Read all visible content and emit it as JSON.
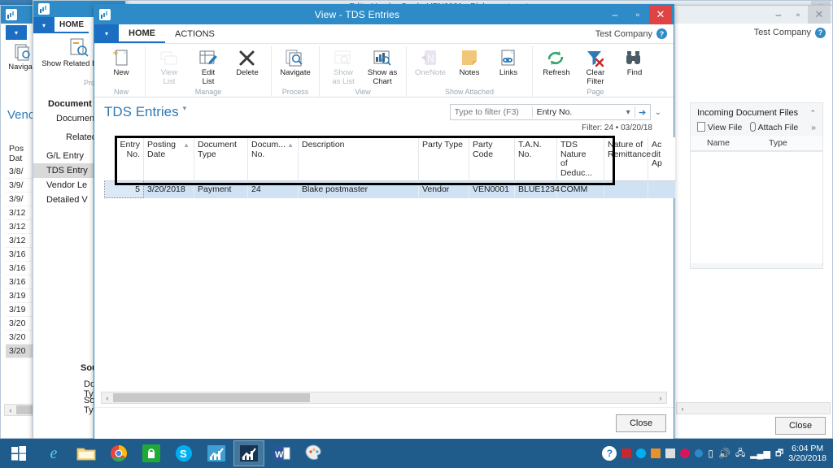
{
  "desktop": {
    "background_color": "#2f6a9c"
  },
  "back_window_right": {
    "title": "Edit - Vendor Card - VEN0001 - Blake postmaster",
    "company": "Test Company",
    "help_icon": "help-icon",
    "minimize": "–",
    "maximize": "▫",
    "close": "✕",
    "close_button": "Close"
  },
  "back_window_left": {
    "title_icon": "chart-app-icon",
    "tab_home": "HOME",
    "ribbon": {
      "show_related_entries": "Show Related Entries",
      "group_process": "Process",
      "navigate": "Navigate"
    },
    "sections": {
      "document": "Document",
      "document_no_label": "Document N",
      "related_entries_label": "Related E",
      "source": "Source",
      "document_type_label": "Document Ty",
      "source_type_label": "Source Type:"
    },
    "related_entries": [
      {
        "label": "G/L Entry",
        "selected": false
      },
      {
        "label": "TDS Entry",
        "selected": true
      },
      {
        "label": "Vendor Le",
        "selected": false
      },
      {
        "label": "Detailed V",
        "selected": false
      }
    ],
    "vendor_title": "Venc",
    "date_column_header_1": "Pos",
    "date_column_header_2": "Dat",
    "dates": [
      "3/8/",
      "3/9/",
      "3/9/",
      "3/12",
      "3/12",
      "3/12",
      "3/16",
      "3/16",
      "3/16",
      "3/19",
      "3/19",
      "3/20",
      "3/20",
      "3/20"
    ],
    "selected_date_index": 13
  },
  "dialog": {
    "title": "View - TDS Entries",
    "title_icon": "chart-app-icon",
    "minimize": "–",
    "maximize": "▫",
    "close": "✕",
    "company": "Test Company",
    "help_icon": "help-icon",
    "file_menu_icon": "chevron-down-icon",
    "tabs": [
      {
        "label": "HOME",
        "active": true
      },
      {
        "label": "ACTIONS",
        "active": false
      }
    ],
    "ribbon_groups": [
      {
        "label": "New",
        "buttons": [
          {
            "label": "New",
            "icon": "new-document-icon",
            "disabled": false
          }
        ]
      },
      {
        "label": "Manage",
        "buttons": [
          {
            "label": "View\nList",
            "icon": "view-list-icon",
            "disabled": true
          },
          {
            "label": "Edit\nList",
            "icon": "edit-list-icon",
            "disabled": false
          },
          {
            "label": "Delete",
            "icon": "delete-x-icon",
            "disabled": false
          }
        ]
      },
      {
        "label": "Process",
        "buttons": [
          {
            "label": "Navigate",
            "icon": "navigate-search-icon",
            "disabled": false
          }
        ]
      },
      {
        "label": "View",
        "buttons": [
          {
            "label": "Show\nas List",
            "icon": "show-as-list-icon",
            "disabled": true
          },
          {
            "label": "Show as\nChart",
            "icon": "show-as-chart-icon",
            "disabled": false
          }
        ]
      },
      {
        "label": "Show Attached",
        "buttons": [
          {
            "label": "OneNote",
            "icon": "onenote-icon",
            "disabled": true
          },
          {
            "label": "Notes",
            "icon": "notes-icon",
            "disabled": false
          },
          {
            "label": "Links",
            "icon": "links-icon",
            "disabled": false
          }
        ]
      },
      {
        "label": "Page",
        "buttons": [
          {
            "label": "Refresh",
            "icon": "refresh-icon",
            "disabled": false
          },
          {
            "label": "Clear\nFilter",
            "icon": "clear-filter-icon",
            "disabled": false
          },
          {
            "label": "Find",
            "icon": "find-binoculars-icon",
            "disabled": false
          }
        ]
      }
    ],
    "page_title": "TDS Entries",
    "page_title_caret": "▾",
    "search": {
      "placeholder": "Type to filter (F3)",
      "field_value": "Entry No.",
      "dropdown_icon": "chevron-down-icon",
      "go_icon": "arrow-right-icon",
      "expand_icon": "chevron-down-icon"
    },
    "filter_status": "Filter: 24 • 03/20/18",
    "grid": {
      "columns": [
        {
          "label": "Entry No.",
          "align": "right",
          "sort": false
        },
        {
          "label": "Posting\nDate",
          "align": "left",
          "sort": true
        },
        {
          "label": "Document\nType",
          "align": "left",
          "sort": false
        },
        {
          "label": "Docum...\nNo.",
          "align": "left",
          "sort": true
        },
        {
          "label": "Description",
          "align": "left",
          "sort": false
        },
        {
          "label": "Party Type",
          "align": "left",
          "sort": false
        },
        {
          "label": "Party Code",
          "align": "left",
          "sort": false
        },
        {
          "label": "T.A.N. No.",
          "align": "left",
          "sort": false
        },
        {
          "label": "TDS Nature\nof Deduc...",
          "align": "left",
          "sort": false
        },
        {
          "label": "Nature of\nRemittance",
          "align": "left",
          "sort": false
        },
        {
          "label": "Ac dit\nAp",
          "align": "left",
          "sort": false
        }
      ],
      "rows": [
        {
          "selected": true,
          "cells": [
            "5",
            "3/20/2018",
            "Payment",
            "24",
            "Blake postmaster",
            "Vendor",
            "VEN0001",
            "BLUE1234",
            "COMM",
            "",
            ""
          ]
        }
      ]
    },
    "scroll": {
      "left_arrow": "‹",
      "right_arrow": "›"
    },
    "close_button": "Close"
  },
  "factbox": {
    "title": "Incoming Document Files",
    "collapse_icon": "chevron-up-icon",
    "actions": [
      {
        "label": "View File",
        "icon": "document-icon"
      },
      {
        "label": "Attach File",
        "icon": "paperclip-icon"
      }
    ],
    "more_icon": "»",
    "columns": [
      "Name",
      "Type"
    ],
    "rows": []
  },
  "taskbar": {
    "start_icon": "windows-start-icon",
    "items": [
      {
        "name": "internet-explorer-icon",
        "active": false
      },
      {
        "name": "file-explorer-icon",
        "active": false
      },
      {
        "name": "chrome-icon",
        "active": false
      },
      {
        "name": "store-icon",
        "active": false
      },
      {
        "name": "skype-icon",
        "active": false
      },
      {
        "name": "dynamics-nav-icon",
        "active": false
      },
      {
        "name": "dynamics-nav-icon-2",
        "active": true
      },
      {
        "name": "word-icon",
        "active": false
      },
      {
        "name": "paint-icon",
        "active": false
      }
    ],
    "tray": [
      "help-circle-icon",
      "acrobat-icon",
      "skype-tray-icon",
      "adobe-icon",
      "shield-check-icon",
      "opera-icon",
      "misc-icon",
      "battery-icon",
      "volume-icon",
      "network-icon",
      "signal-icon",
      "action-center-icon"
    ],
    "clock_time": "6:04 PM",
    "clock_date": "3/20/2018"
  }
}
